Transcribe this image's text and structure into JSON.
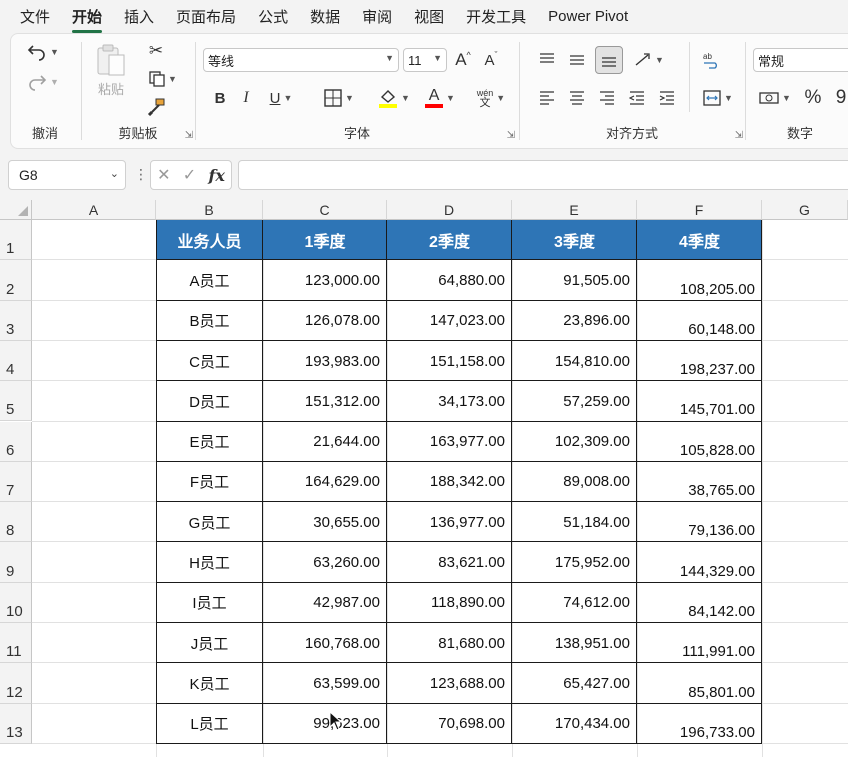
{
  "menu": {
    "tabs": [
      "文件",
      "开始",
      "插入",
      "页面布局",
      "公式",
      "数据",
      "审阅",
      "视图",
      "开发工具",
      "Power Pivot"
    ],
    "active": "开始"
  },
  "ribbon": {
    "groups": {
      "undo": "撤消",
      "clipboard": "剪贴板",
      "font": "字体",
      "align": "对齐方式",
      "number": "数字"
    },
    "paste_label": "粘贴",
    "font_name": "等线",
    "font_size": "11",
    "number_format": "常规",
    "bold": "B",
    "italic": "I",
    "underline": "U",
    "grow_font": "A",
    "shrink_font": "A",
    "font_color_letter": "A",
    "phonetic": "wén",
    "percent": "%",
    "comma": "9",
    "colors": {
      "highlight": "#ffff00",
      "font_color": "#ff0000",
      "accent": "#217346"
    }
  },
  "formula_bar": {
    "name_box": "G8",
    "fx": "fx",
    "content": ""
  },
  "sheet": {
    "columns": [
      "A",
      "B",
      "C",
      "D",
      "E",
      "F",
      "G"
    ],
    "rows": [
      "1",
      "2",
      "3",
      "4",
      "5",
      "6",
      "7",
      "8",
      "9",
      "10",
      "11",
      "12",
      "13"
    ],
    "table_header": [
      "业务人员",
      "1季度",
      "2季度",
      "3季度",
      "4季度"
    ],
    "header_color": "#2e75b6",
    "table_rows": [
      [
        "A员工",
        "123,000.00",
        "64,880.00",
        "91,505.00",
        "108,205.00"
      ],
      [
        "B员工",
        "126,078.00",
        "147,023.00",
        "23,896.00",
        "60,148.00"
      ],
      [
        "C员工",
        "193,983.00",
        "151,158.00",
        "154,810.00",
        "198,237.00"
      ],
      [
        "D员工",
        "151,312.00",
        "34,173.00",
        "57,259.00",
        "145,701.00"
      ],
      [
        "E员工",
        "21,644.00",
        "163,977.00",
        "102,309.00",
        "105,828.00"
      ],
      [
        "F员工",
        "164,629.00",
        "188,342.00",
        "89,008.00",
        "38,765.00"
      ],
      [
        "G员工",
        "30,655.00",
        "136,977.00",
        "51,184.00",
        "79,136.00"
      ],
      [
        "H员工",
        "63,260.00",
        "83,621.00",
        "175,952.00",
        "144,329.00"
      ],
      [
        "I员工",
        "42,987.00",
        "118,890.00",
        "74,612.00",
        "84,142.00"
      ],
      [
        "J员工",
        "160,768.00",
        "81,680.00",
        "138,951.00",
        "111,991.00"
      ],
      [
        "K员工",
        "63,599.00",
        "123,688.00",
        "65,427.00",
        "85,801.00"
      ],
      [
        "L员工",
        "99,623.00",
        "70,698.00",
        "170,434.00",
        "196,733.00"
      ]
    ]
  }
}
